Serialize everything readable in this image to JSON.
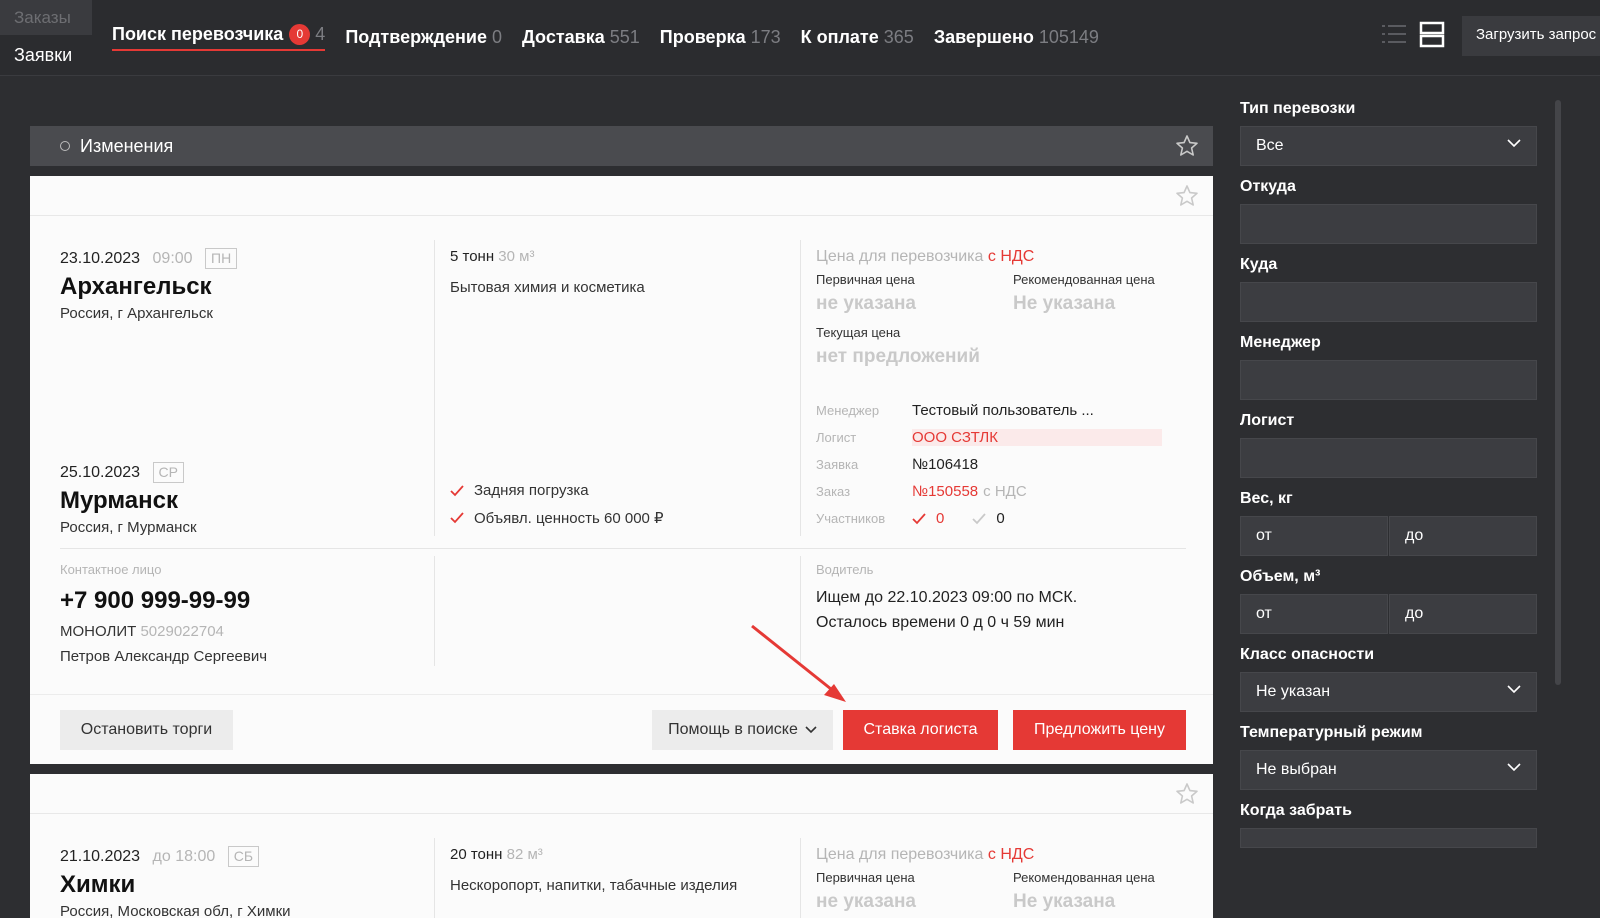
{
  "nav": {
    "orders": "Заказы",
    "requests": "Заявки"
  },
  "tabs": [
    {
      "label": "Поиск перевозчика",
      "badge": "0",
      "count": "4"
    },
    {
      "label": "Подтверждение",
      "count": "0"
    },
    {
      "label": "Доставка",
      "count": "551"
    },
    {
      "label": "Проверка",
      "count": "173"
    },
    {
      "label": "К оплате",
      "count": "365"
    },
    {
      "label": "Завершено",
      "count": "105149"
    }
  ],
  "header": {
    "upload_label": "Загрузить запрос"
  },
  "changes": {
    "label": "Изменения"
  },
  "card1": {
    "from": {
      "date": "23.10.2023",
      "time": "09:00",
      "weekday": "ПН",
      "city": "Архангельск",
      "address": "Россия, г Архангельск"
    },
    "to": {
      "date": "25.10.2023",
      "weekday": "СР",
      "city": "Мурманск",
      "address": "Россия, г Мурманск"
    },
    "cargo": {
      "weight": "5 тонн",
      "volume": "30 м³",
      "description": "Бытовая химия и косметика",
      "features": [
        "Задняя погрузка",
        "Объявл. ценность 60 000 ₽"
      ]
    },
    "price": {
      "title": "Цена для перевозчика",
      "vat": "с НДС",
      "primary_label": "Первичная цена",
      "primary_value": "не указана",
      "recommended_label": "Рекомендованная цена",
      "recommended_value": "Не указана",
      "current_label": "Текущая цена",
      "current_value": "нет предложений"
    },
    "details": {
      "manager_label": "Менеджер",
      "manager_value": "Тестовый пользователь ...",
      "logist_label": "Логист",
      "logist_value": "ООО СЗТЛК",
      "request_label": "Заявка",
      "request_value": "№106418",
      "order_label": "Заказ",
      "order_value": "№150558",
      "order_vat": "с НДС",
      "participants_label": "Участников",
      "participants_a": "0",
      "participants_b": "0"
    },
    "contact": {
      "label": "Контактное лицо",
      "phone": "+7 900 999-99-99",
      "company": "МОНОЛИТ",
      "inn": "5029022704",
      "person": "Петров Александр Сергеевич"
    },
    "driver": {
      "label": "Водитель",
      "line1": "Ищем до 22.10.2023 09:00 по МСК.",
      "line2": "Осталось времени 0 д 0 ч 59 мин"
    },
    "actions": {
      "stop": "Остановить торги",
      "help": "Помощь в поиске",
      "logist_bid": "Ставка логиста",
      "offer": "Предложить цену"
    }
  },
  "card2": {
    "from": {
      "date": "21.10.2023",
      "time": "до 18:00",
      "weekday": "СБ",
      "city": "Химки",
      "address": "Россия, Московская обл, г Химки"
    },
    "cargo": {
      "weight": "20 тонн",
      "volume": "82 м³",
      "description": "Нескоропорт, напитки, табачные изделия"
    },
    "price": {
      "title": "Цена для перевозчика",
      "vat": "с НДС",
      "primary_label": "Первичная цена",
      "primary_value": "не указана",
      "recommended_label": "Рекомендованная цена",
      "recommended_value": "Не указана"
    }
  },
  "filters": {
    "transport_type": {
      "label": "Тип перевозки",
      "value": "Все"
    },
    "from": {
      "label": "Откуда"
    },
    "to": {
      "label": "Куда"
    },
    "manager": {
      "label": "Менеджер"
    },
    "logist": {
      "label": "Логист"
    },
    "weight": {
      "label": "Вес, кг",
      "from_ph": "от",
      "to_ph": "до"
    },
    "volume": {
      "label": "Объем, м³",
      "from_ph": "от",
      "to_ph": "до"
    },
    "hazard": {
      "label": "Класс опасности",
      "value": "Не указан"
    },
    "temperature": {
      "label": "Температурный режим",
      "value": "Не выбран"
    },
    "pickup": {
      "label": "Когда забрать"
    }
  },
  "colors": {
    "accent": "#e53935",
    "background": "#2d2e31",
    "card": "#fbfbfb"
  }
}
